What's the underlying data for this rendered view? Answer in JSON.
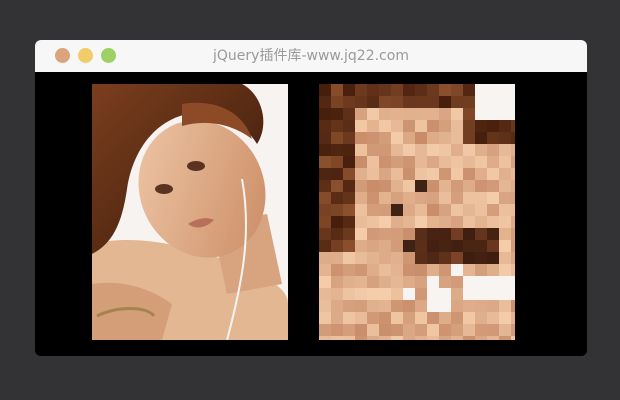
{
  "window": {
    "title": "jQuery插件库-www.jq22.com",
    "controls": [
      {
        "name": "close-button",
        "color": "#dba47c"
      },
      {
        "name": "minimize-button",
        "color": "#f0cc6a"
      },
      {
        "name": "maximize-button",
        "color": "#9dd163"
      }
    ]
  },
  "images": [
    {
      "name": "original-portrait-image",
      "alt": "portrait photo of a woman resting her head on her arm"
    },
    {
      "name": "pixelated-portrait-image",
      "alt": "pixelated version of the same portrait"
    }
  ],
  "colors": {
    "page_background": "#333336",
    "titlebar_background": "#f7f7f7",
    "title_text": "#9a9a9a",
    "content_background": "#000000"
  }
}
